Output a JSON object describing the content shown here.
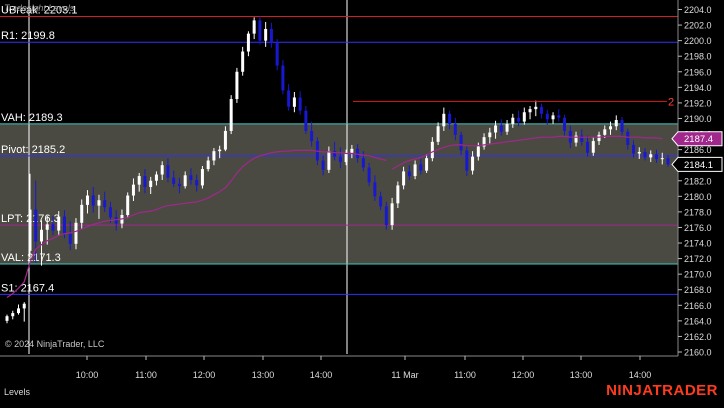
{
  "window": {
    "indicator_title": "Tradesight Levels",
    "copyright": "© 2024 NinjaTrader, LLC",
    "tab_label": "Levels",
    "brand": "NINJATRADER"
  },
  "chart_data": {
    "type": "candlestick",
    "ylim": [
      2160,
      2205
    ],
    "y_ticks": [
      2160,
      2162,
      2164,
      2166,
      2168,
      2170,
      2172,
      2174,
      2176,
      2178,
      2180,
      2182,
      2184,
      2186,
      2188,
      2190,
      2192,
      2194,
      2196,
      2198,
      2200,
      2202,
      2204
    ],
    "x_tick_labels": [
      "10:00",
      "11:00",
      "12:00",
      "13:00",
      "14:00",
      "11 Mar",
      "11:00",
      "12:00",
      "13:00",
      "14:00"
    ],
    "session_separators": [
      "09:30 day 1",
      "14:45 day 1 / session 2 start"
    ],
    "levels": [
      {
        "label": "UBreak: 2203.1",
        "value": 2203.1,
        "color": "#d22020"
      },
      {
        "label": "R1: 2199.8",
        "value": 2199.8,
        "color": "#3030ff"
      },
      {
        "label": "VAH: 2189.3",
        "value": 2189.3,
        "color": "#40c8c0"
      },
      {
        "label": "Pivot: 2185.2",
        "value": 2185.2,
        "color": "#3030ff"
      },
      {
        "label": "LPT: 2176.3",
        "value": 2176.3,
        "color": "#a0288c"
      },
      {
        "label": "VAL: 2171.3",
        "value": 2171.3,
        "color": "#40c8c0"
      },
      {
        "label": "S1: 2167.4",
        "value": 2167.4,
        "color": "#3030ff"
      }
    ],
    "value_area": {
      "high": 2189.3,
      "low": 2171.3
    },
    "annotation": {
      "text": "2",
      "value": 2192.2
    },
    "price_markers": [
      {
        "value": 2187.4,
        "text": "2187.4",
        "color": "#a0288c"
      },
      {
        "value": 2184.1,
        "text": "2184.1",
        "color": "#000000"
      }
    ],
    "candles": [
      [
        2164.0,
        2164.8,
        2163.7,
        2164.6
      ],
      [
        2164.6,
        2165.3,
        2164.2,
        2165.0
      ],
      [
        2165.0,
        2166.1,
        2164.8,
        2165.6
      ],
      [
        2165.6,
        2166.4,
        2163.9,
        2166.2
      ],
      [
        2173.0,
        2182.9,
        2172.2,
        2178.3
      ],
      [
        2178.3,
        2182.0,
        2171.5,
        2174.2
      ],
      [
        2174.2,
        2176.9,
        2171.1,
        2175.7
      ],
      [
        2175.7,
        2177.5,
        2173.8,
        2176.4
      ],
      [
        2176.4,
        2177.5,
        2175.0,
        2175.6
      ],
      [
        2175.6,
        2178.1,
        2174.9,
        2177.4
      ],
      [
        2177.4,
        2178.2,
        2174.6,
        2175.2
      ],
      [
        2175.2,
        2176.8,
        2173.1,
        2173.9
      ],
      [
        2173.9,
        2177.2,
        2173.2,
        2176.6
      ],
      [
        2176.6,
        2179.6,
        2175.8,
        2178.9
      ],
      [
        2178.9,
        2180.8,
        2177.8,
        2180.1
      ],
      [
        2180.1,
        2181.2,
        2177.9,
        2178.8
      ],
      [
        2178.8,
        2180.2,
        2177.1,
        2179.5
      ],
      [
        2179.5,
        2180.6,
        2178.0,
        2178.6
      ],
      [
        2178.6,
        2179.3,
        2176.6,
        2177.3
      ],
      [
        2177.3,
        2178.2,
        2175.6,
        2176.5
      ],
      [
        2176.5,
        2178.3,
        2175.9,
        2177.6
      ],
      [
        2177.6,
        2180.5,
        2177.2,
        2180.1
      ],
      [
        2180.1,
        2182.3,
        2179.4,
        2181.5
      ],
      [
        2181.5,
        2183.0,
        2180.6,
        2182.6
      ],
      [
        2182.6,
        2183.5,
        2180.4,
        2181.2
      ],
      [
        2181.2,
        2182.5,
        2180.3,
        2182.0
      ],
      [
        2182.0,
        2183.2,
        2181.4,
        2182.8
      ],
      [
        2182.8,
        2184.5,
        2182.1,
        2184.0
      ],
      [
        2184.0,
        2184.9,
        2181.8,
        2182.4
      ],
      [
        2182.4,
        2183.3,
        2181.2,
        2181.6
      ],
      [
        2181.6,
        2182.4,
        2180.4,
        2181.3
      ],
      [
        2181.3,
        2183.2,
        2181.0,
        2182.7
      ],
      [
        2182.7,
        2183.6,
        2181.5,
        2182.1
      ],
      [
        2182.1,
        2182.8,
        2180.6,
        2181.4
      ],
      [
        2181.4,
        2183.9,
        2181.0,
        2183.5
      ],
      [
        2183.5,
        2185.1,
        2183.2,
        2184.6
      ],
      [
        2184.6,
        2186.2,
        2184.0,
        2185.8
      ],
      [
        2185.8,
        2186.5,
        2184.9,
        2186.0
      ],
      [
        2186.0,
        2189.0,
        2185.8,
        2188.4
      ],
      [
        2188.4,
        2193.0,
        2188.0,
        2192.5
      ],
      [
        2192.5,
        2196.5,
        2192.0,
        2196.0
      ],
      [
        2196.0,
        2199.2,
        2195.5,
        2198.6
      ],
      [
        2198.6,
        2201.2,
        2198.0,
        2200.9
      ],
      [
        2200.9,
        2203.0,
        2200.2,
        2202.6
      ],
      [
        2202.6,
        2203.1,
        2199.5,
        2200.0
      ],
      [
        2200.0,
        2202.4,
        2199.2,
        2201.5
      ],
      [
        2201.5,
        2202.3,
        2199.1,
        2199.7
      ],
      [
        2199.7,
        2200.2,
        2196.2,
        2196.8
      ],
      [
        2196.8,
        2197.5,
        2193.1,
        2193.6
      ],
      [
        2193.6,
        2194.4,
        2191.0,
        2191.5
      ],
      [
        2191.5,
        2193.4,
        2190.8,
        2192.7
      ],
      [
        2192.7,
        2193.5,
        2190.5,
        2191.0
      ],
      [
        2191.0,
        2191.6,
        2188.0,
        2188.4
      ],
      [
        2188.4,
        2189.6,
        2186.4,
        2187.1
      ],
      [
        2187.1,
        2187.6,
        2184.0,
        2184.6
      ],
      [
        2184.6,
        2185.2,
        2182.7,
        2183.4
      ],
      [
        2183.4,
        2186.4,
        2183.0,
        2185.8
      ],
      [
        2185.8,
        2187.0,
        2184.6,
        2185.1
      ],
      [
        2185.1,
        2186.3,
        2183.6,
        2184.4
      ],
      [
        2184.4,
        2186.0,
        2184.0,
        2185.6
      ],
      [
        2185.6,
        2186.6,
        2184.9,
        2186.1
      ],
      [
        2186.1,
        2186.7,
        2184.3,
        2184.9
      ],
      [
        2184.9,
        2185.8,
        2183.2,
        2183.7
      ],
      [
        2183.7,
        2184.3,
        2181.3,
        2181.8
      ],
      [
        2181.8,
        2182.7,
        2179.4,
        2180.0
      ],
      [
        2180.0,
        2180.6,
        2178.2,
        2178.7
      ],
      [
        2178.7,
        2179.3,
        2175.7,
        2176.3
      ],
      [
        2176.3,
        2179.8,
        2175.7,
        2179.1
      ],
      [
        2179.1,
        2181.9,
        2178.5,
        2181.4
      ],
      [
        2181.4,
        2183.8,
        2180.9,
        2183.2
      ],
      [
        2183.2,
        2184.0,
        2182.1,
        2182.6
      ],
      [
        2182.6,
        2184.6,
        2182.2,
        2184.1
      ],
      [
        2184.1,
        2184.8,
        2182.8,
        2183.3
      ],
      [
        2183.3,
        2185.4,
        2183.0,
        2184.9
      ],
      [
        2184.9,
        2187.6,
        2184.5,
        2187.0
      ],
      [
        2187.0,
        2189.5,
        2186.6,
        2189.0
      ],
      [
        2189.0,
        2191.4,
        2188.4,
        2190.6
      ],
      [
        2190.6,
        2191.0,
        2188.6,
        2189.3
      ],
      [
        2189.3,
        2190.1,
        2187.2,
        2187.9
      ],
      [
        2187.9,
        2188.3,
        2185.3,
        2185.9
      ],
      [
        2185.9,
        2186.4,
        2182.6,
        2183.3
      ],
      [
        2183.3,
        2185.8,
        2182.8,
        2185.1
      ],
      [
        2185.1,
        2186.9,
        2184.6,
        2186.4
      ],
      [
        2186.4,
        2188.1,
        2186.0,
        2187.6
      ],
      [
        2187.6,
        2188.8,
        2186.8,
        2188.2
      ],
      [
        2188.2,
        2189.7,
        2187.4,
        2189.1
      ],
      [
        2189.1,
        2189.9,
        2187.8,
        2188.3
      ],
      [
        2188.3,
        2189.8,
        2187.9,
        2189.3
      ],
      [
        2189.3,
        2190.6,
        2188.8,
        2190.1
      ],
      [
        2190.1,
        2191.0,
        2189.0,
        2189.6
      ],
      [
        2189.6,
        2191.4,
        2189.2,
        2190.8
      ],
      [
        2190.8,
        2191.6,
        2189.9,
        2191.2
      ],
      [
        2191.2,
        2192.3,
        2190.3,
        2191.5
      ],
      [
        2191.5,
        2191.9,
        2190.0,
        2190.6
      ],
      [
        2190.6,
        2191.1,
        2189.2,
        2189.9
      ],
      [
        2189.9,
        2190.8,
        2189.3,
        2190.4
      ],
      [
        2190.4,
        2191.2,
        2189.6,
        2190.1
      ],
      [
        2190.1,
        2190.5,
        2187.8,
        2188.4
      ],
      [
        2188.4,
        2189.1,
        2186.2,
        2186.9
      ],
      [
        2186.9,
        2188.3,
        2186.4,
        2187.8
      ],
      [
        2187.8,
        2188.6,
        2186.5,
        2187.0
      ],
      [
        2187.0,
        2187.8,
        2185.1,
        2185.6
      ],
      [
        2185.6,
        2187.6,
        2185.2,
        2187.1
      ],
      [
        2187.1,
        2188.3,
        2186.6,
        2187.9
      ],
      [
        2187.9,
        2189.1,
        2187.5,
        2188.6
      ],
      [
        2188.6,
        2189.6,
        2187.9,
        2189.0
      ],
      [
        2189.0,
        2190.4,
        2188.5,
        2189.8
      ],
      [
        2189.8,
        2190.2,
        2187.8,
        2188.3
      ],
      [
        2188.3,
        2188.7,
        2186.0,
        2186.6
      ],
      [
        2186.6,
        2187.2,
        2185.0,
        2185.5
      ],
      [
        2185.5,
        2186.3,
        2184.8,
        2185.7
      ],
      [
        2185.7,
        2186.2,
        2184.6,
        2185.0
      ],
      [
        2185.0,
        2185.9,
        2184.4,
        2185.4
      ],
      [
        2185.4,
        2186.0,
        2184.3,
        2184.8
      ],
      [
        2184.8,
        2185.6,
        2184.1,
        2184.9
      ],
      [
        2184.9,
        2185.3,
        2183.8,
        2184.1
      ]
    ],
    "vwap": [
      2167.0,
      2167.5,
      2168.2,
      2169.0,
      2171.5,
      2173.2,
      2173.8,
      2174.3,
      2174.6,
      2175.0,
      2175.2,
      2175.3,
      2175.5,
      2175.8,
      2176.1,
      2176.4,
      2176.6,
      2176.8,
      2176.9,
      2177.0,
      2177.1,
      2177.3,
      2177.6,
      2177.9,
      2178.0,
      2178.1,
      2178.3,
      2178.6,
      2178.8,
      2178.9,
      2179.0,
      2179.1,
      2179.2,
      2179.3,
      2179.5,
      2179.8,
      2180.2,
      2180.6,
      2181.1,
      2182.0,
      2183.0,
      2183.8,
      2184.4,
      2184.9,
      2185.2,
      2185.4,
      2185.6,
      2185.7,
      2185.8,
      2185.8,
      2185.9,
      2185.9,
      2185.9,
      2185.9,
      2185.8,
      2185.7,
      2185.7,
      2185.6,
      2185.6,
      2185.5,
      2185.5,
      2185.4,
      2185.3,
      2185.2,
      2185.0,
      2184.8,
      2184.6,
      2183.5,
      2183.9,
      2184.3,
      2184.6,
      2184.8,
      2185.0,
      2185.3,
      2185.7,
      2186.0,
      2186.3,
      2186.5,
      2186.6,
      2186.6,
      2186.5,
      2186.5,
      2186.5,
      2186.6,
      2186.7,
      2186.8,
      2186.9,
      2187.0,
      2187.1,
      2187.2,
      2187.3,
      2187.4,
      2187.5,
      2187.6,
      2187.6,
      2187.6,
      2187.7,
      2187.7,
      2187.6,
      2187.6,
      2187.6,
      2187.6,
      2187.6,
      2187.6,
      2187.7,
      2187.7,
      2187.7,
      2187.7,
      2187.6,
      2187.6,
      2187.6,
      2187.5,
      2187.5,
      2187.5,
      2187.4
    ],
    "session2_start_index": 67
  },
  "colors": {
    "bull": "#ffffff",
    "bear": "#1818d0",
    "value_area_fill": "#4a4a42",
    "vwap": "#a0288c",
    "background": "#000000",
    "brand": "#ff3b1f"
  }
}
